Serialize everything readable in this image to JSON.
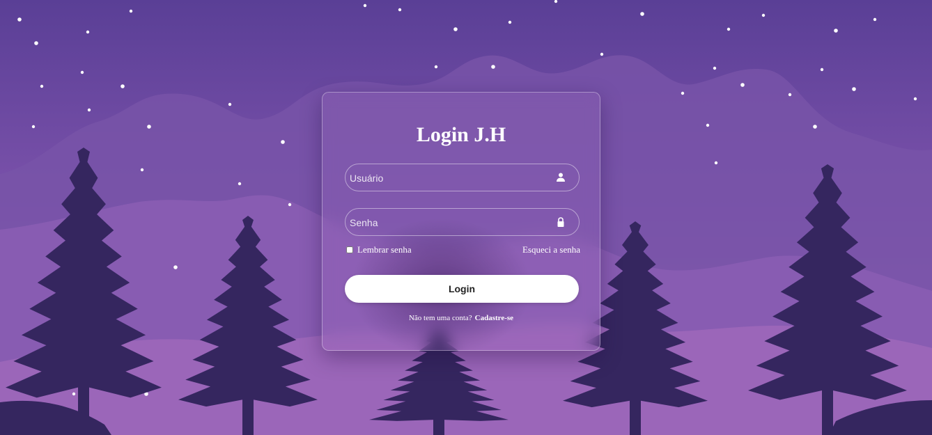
{
  "page": {
    "title": "Login J.H"
  },
  "form": {
    "username_placeholder": "Usuário",
    "username_value": "",
    "password_placeholder": "Senha",
    "password_value": "",
    "remember_label": "Lembrar senha",
    "remember_checked": false,
    "forgot_label": "Esqueci a senha",
    "submit_label": "Login",
    "signup_prompt": "Não tem uma conta?",
    "signup_link": "Cadastre-se"
  },
  "icons": {
    "username": "user-icon",
    "password": "lock-icon"
  },
  "colors": {
    "sky_top": "#5a3f96",
    "sky_bottom": "#b27bc3",
    "mountain_far": "#7c55a9",
    "mountain_near": "#6f4aa0",
    "trees": "#35265f",
    "button_bg": "#ffffff",
    "text": "#ffffff"
  }
}
